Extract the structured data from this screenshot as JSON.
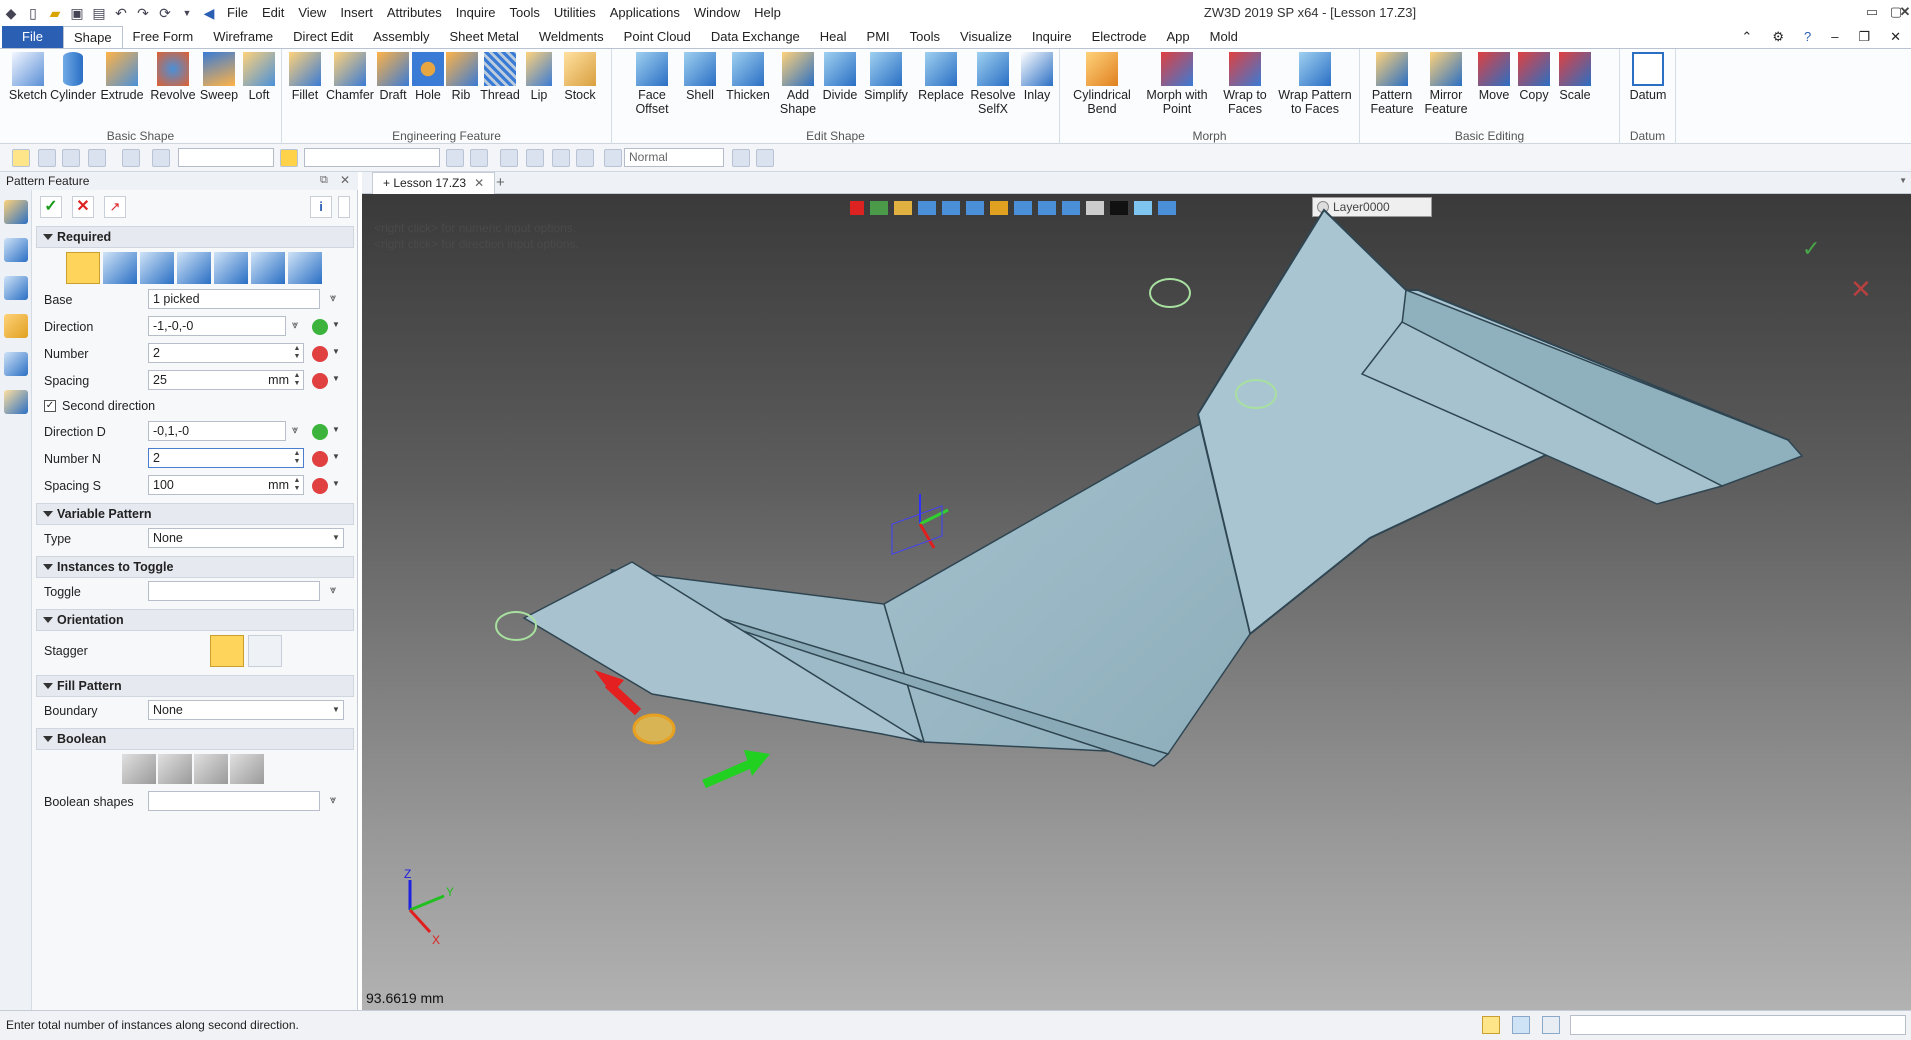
{
  "app": {
    "title": "ZW3D 2019 SP x64 - [Lesson 17.Z3]"
  },
  "menu": [
    "File",
    "Edit",
    "View",
    "Insert",
    "Attributes",
    "Inquire",
    "Tools",
    "Utilities",
    "Applications",
    "Window",
    "Help"
  ],
  "ribbon_tabs": [
    "File",
    "Shape",
    "Free Form",
    "Wireframe",
    "Direct Edit",
    "Assembly",
    "Sheet Metal",
    "Weldments",
    "Point Cloud",
    "Data Exchange",
    "Heal",
    "PMI",
    "Tools",
    "Visualize",
    "Inquire",
    "Electrode",
    "App",
    "Mold"
  ],
  "ribbon_groups": {
    "basic_shape": {
      "label": "Basic Shape",
      "buttons": [
        "Sketch",
        "Cylinder",
        "Extrude",
        "Revolve",
        "Sweep",
        "Loft"
      ]
    },
    "engineering": {
      "label": "Engineering Feature",
      "buttons": [
        "Fillet",
        "Chamfer",
        "Draft",
        "Hole",
        "Rib",
        "Thread",
        "Lip",
        "Stock"
      ]
    },
    "edit_shape": {
      "label": "Edit Shape",
      "buttons": [
        "Face Offset",
        "Shell",
        "Thicken",
        "Add Shape",
        "Divide",
        "Simplify",
        "Replace",
        "Resolve SelfX",
        "Inlay"
      ]
    },
    "morph": {
      "label": "Morph",
      "buttons": [
        "Cylindrical Bend",
        "Morph with Point",
        "Wrap to Faces",
        "Wrap Pattern to Faces"
      ]
    },
    "basic_editing": {
      "label": "Basic Editing",
      "buttons": [
        "Pattern Feature",
        "Mirror Feature",
        "Move",
        "Copy",
        "Scale"
      ]
    },
    "datum": {
      "label": "Datum",
      "buttons": [
        "Datum"
      ]
    }
  },
  "toolbar2": {
    "filter_value": "Normal"
  },
  "panel": {
    "title": "Pattern Feature",
    "sections": {
      "required": "Required",
      "variable": "Variable Pattern",
      "toggle": "Instances to Toggle",
      "orientation": "Orientation",
      "fill": "Fill Pattern",
      "boolean": "Boolean"
    },
    "fields": {
      "base": {
        "label": "Base",
        "value": "1 picked"
      },
      "direction": {
        "label": "Direction",
        "value": "-1,-0,-0"
      },
      "number": {
        "label": "Number",
        "value": "2"
      },
      "spacing": {
        "label": "Spacing",
        "value": "25",
        "unit": "mm"
      },
      "second_direction": {
        "label": "Second direction",
        "checked": true
      },
      "direction_d": {
        "label": "Direction  D",
        "value": "-0,1,-0"
      },
      "number_n": {
        "label": "Number  N",
        "value": "2"
      },
      "spacing_s": {
        "label": "Spacing  S",
        "value": "100",
        "unit": "mm"
      },
      "type": {
        "label": "Type",
        "value": "None"
      },
      "toggle": {
        "label": "Toggle",
        "value": ""
      },
      "stagger": {
        "label": "Stagger"
      },
      "boundary": {
        "label": "Boundary",
        "value": "None"
      },
      "boolean_shapes": {
        "label": "Boolean shapes",
        "value": ""
      }
    }
  },
  "document": {
    "tab": "Lesson 17.Z3",
    "layer": "Layer0000",
    "hint1": "<right click> for numeric input options.",
    "hint2": "<right click> for direction input options.",
    "measure": "93.6619 mm"
  },
  "status": {
    "message": "Enter total number of instances along second direction."
  },
  "colors": {
    "accent": "#2b5fb4",
    "model": "#a6c2cf",
    "viewport_top": "#3a3a3a",
    "viewport_bottom": "#b2b2b2"
  }
}
